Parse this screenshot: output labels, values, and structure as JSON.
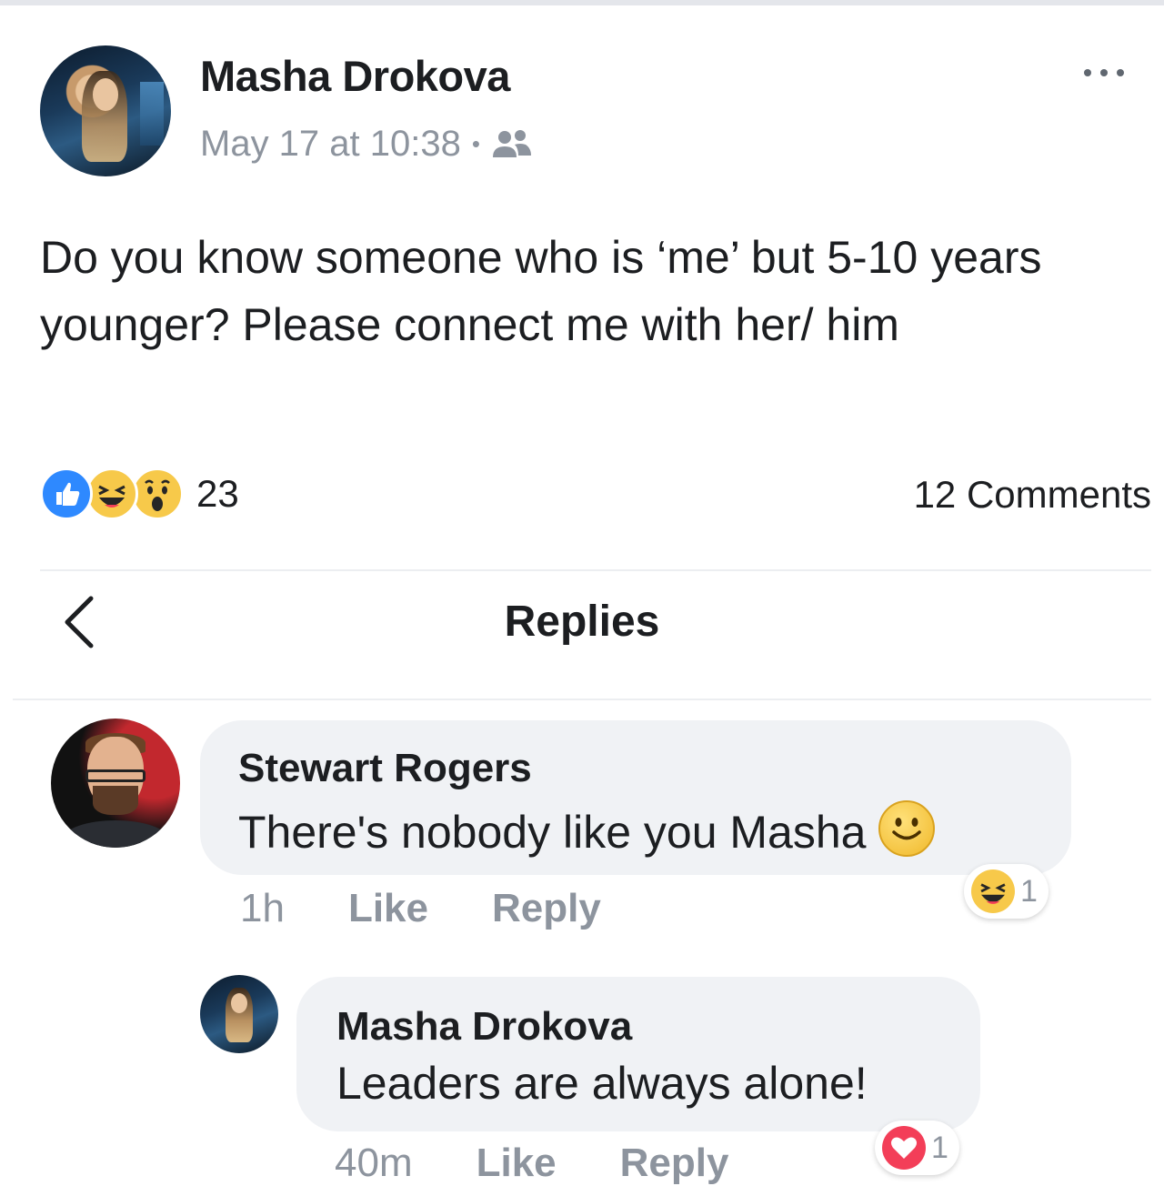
{
  "post": {
    "author": "Masha Drokova",
    "timestamp": "May 17 at 10:38",
    "separator": "•",
    "audience_icon": "friends-icon",
    "text": "Do you know someone who is ‘me’ but 5-10 years younger? Please connect me with her/ him",
    "reaction_count": "23",
    "reactions": [
      "like",
      "haha",
      "wow"
    ],
    "comments_label": "12 Comments"
  },
  "replies_header": {
    "title": "Replies",
    "back_icon": "chevron-left-icon"
  },
  "comments": [
    {
      "author": "Stewart Rogers",
      "text": "There's nobody like you Masha",
      "emoji": "smile",
      "time": "1h",
      "like_label": "Like",
      "reply_label": "Reply",
      "reaction": "haha",
      "reaction_count": "1"
    },
    {
      "author": "Masha Drokova",
      "text": "Leaders are always alone!",
      "time": "40m",
      "like_label": "Like",
      "reply_label": "Reply",
      "reaction": "love",
      "reaction_count": "1"
    }
  ],
  "colors": {
    "like_blue": "#2e89ff",
    "meta_gray": "#8d949e",
    "bubble_bg": "#f0f2f5",
    "love_red": "#f33e58",
    "haha_yellow": "#f7c94a"
  }
}
